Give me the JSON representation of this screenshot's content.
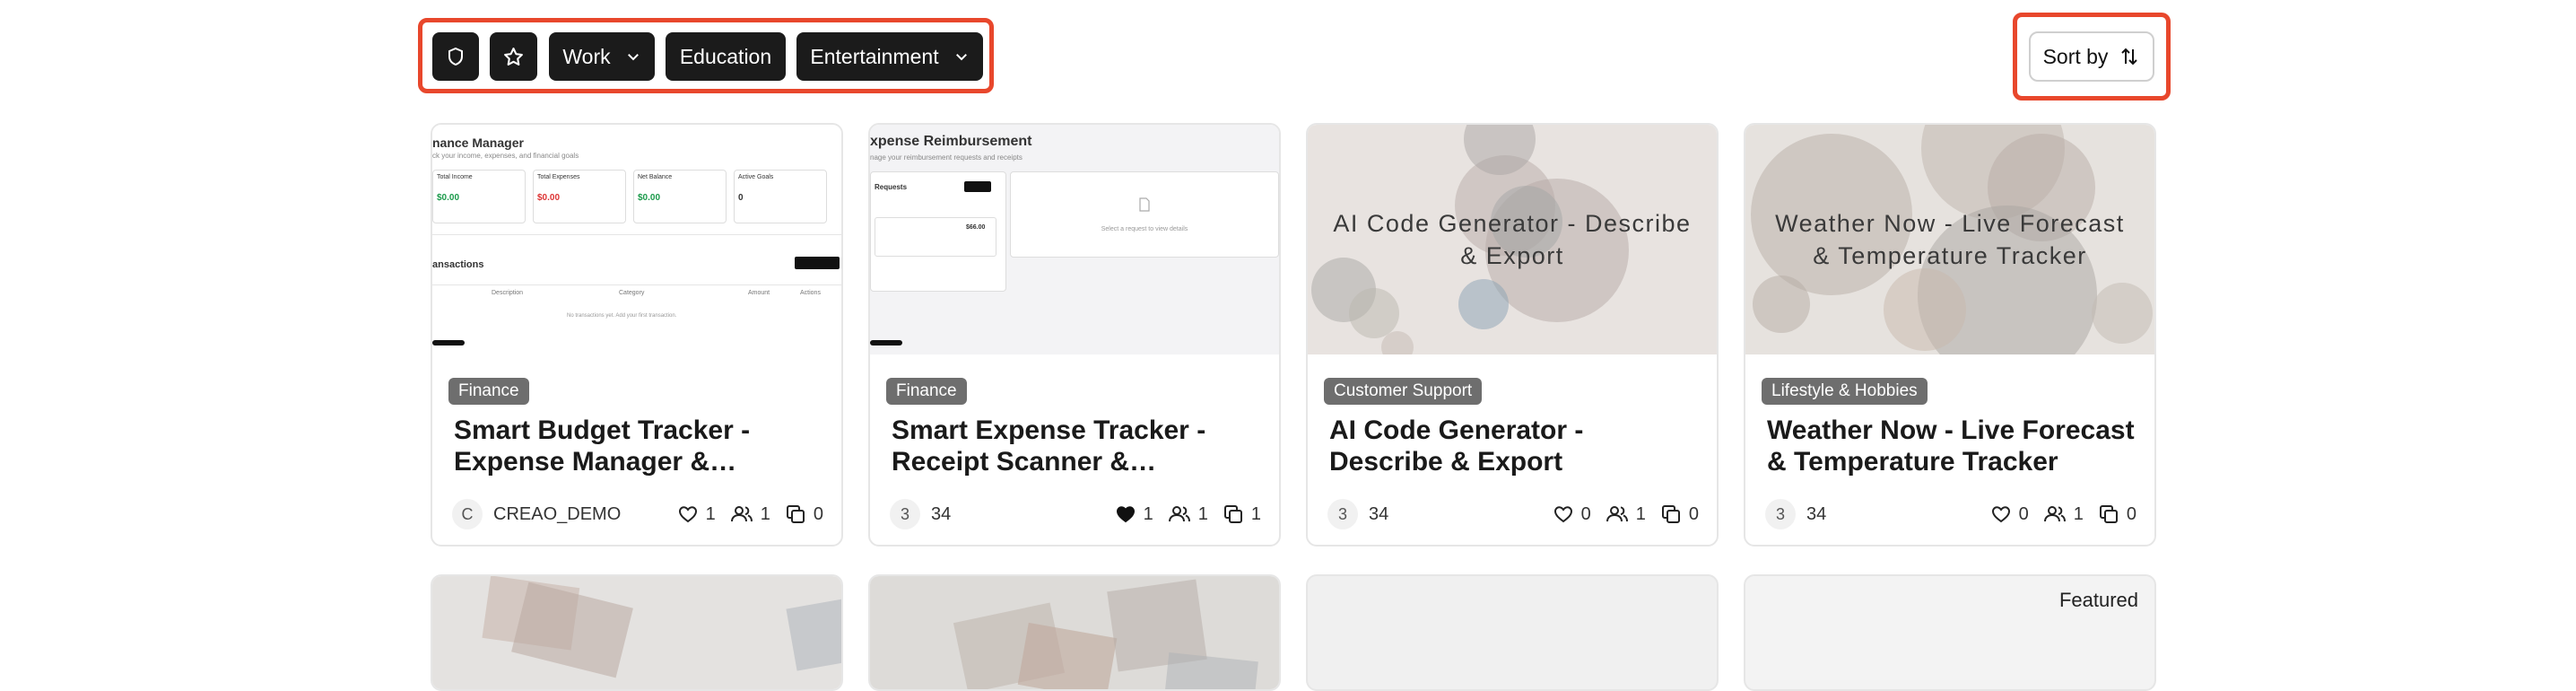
{
  "filters": {
    "work_label": "Work",
    "education_label": "Education",
    "entertainment_label": "Entertainment"
  },
  "sort": {
    "label": "Sort by"
  },
  "cards": [
    {
      "category": "Finance",
      "title": "Smart Budget Tracker - Expense Manager & Finance…",
      "avatar": "C",
      "author": "CREAO_DEMO",
      "likes": "1",
      "users": "1",
      "copies": "0",
      "thumb": {
        "app_title": "nance Manager",
        "app_sub": "ck your income, expenses, and financial goals",
        "cards": [
          "Total Income",
          "Total Expenses",
          "Net Balance",
          "Active Goals"
        ],
        "values": [
          "$0.00",
          "$0.00",
          "$0.00",
          "0"
        ],
        "section": "ansactions",
        "cols": [
          "Description",
          "Category",
          "Amount",
          "Actions"
        ],
        "empty": "No transactions yet. Add your first transaction."
      }
    },
    {
      "category": "Finance",
      "title": "Smart Expense Tracker - Receipt Scanner &…",
      "avatar": "3",
      "author": "34",
      "likes": "1",
      "users": "1",
      "copies": "1",
      "thumb": {
        "app_title": "xpense Reimbursement",
        "app_sub": "nage your reimbursement requests and receipts",
        "requests": "Requests",
        "amount": "$66.00",
        "empty": "Select a request to view details"
      }
    },
    {
      "category": "Customer Support",
      "title": "AI Code Generator - Describe & Export",
      "thumb_text": "AI Code Generator - Describe & Export",
      "avatar": "3",
      "author": "34",
      "likes": "0",
      "users": "1",
      "copies": "0"
    },
    {
      "category": "Lifestyle & Hobbies",
      "title": "Weather Now - Live Forecast & Temperature Tracker",
      "thumb_text": "Weather Now - Live Forecast & Temperature Tracker",
      "avatar": "3",
      "author": "34",
      "likes": "0",
      "users": "1",
      "copies": "0"
    }
  ],
  "row2": {
    "featured_label": "Featured"
  },
  "colors": {
    "highlight": "#e8472c",
    "button_dark": "#1b1b1b",
    "badge": "#6e6e6e"
  }
}
